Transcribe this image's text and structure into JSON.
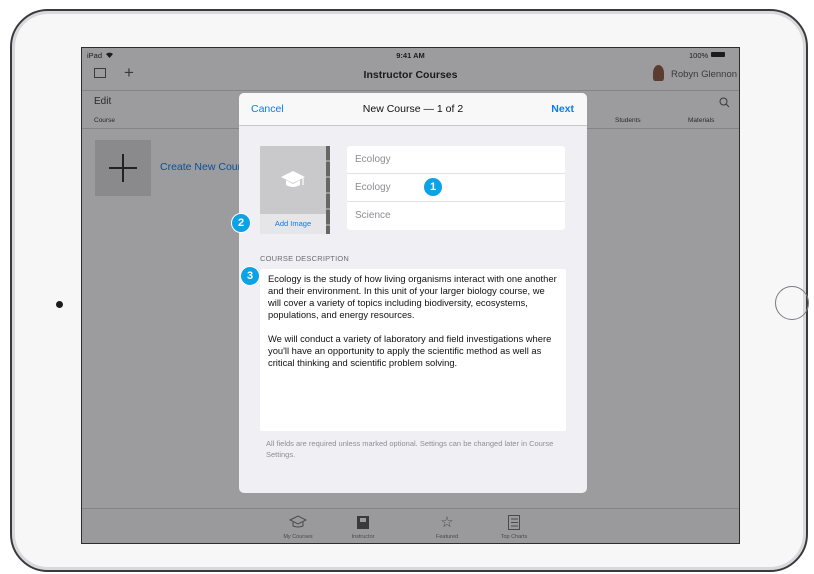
{
  "status": {
    "carrier": "iPad",
    "time": "9:41 AM",
    "battery": "100%"
  },
  "background": {
    "title": "Instructor Courses",
    "user": "Robyn Glennon",
    "edit_label": "Edit",
    "col_course": "Course",
    "col_students": "Students",
    "col_materials": "Materials",
    "create_label": "Create New Course"
  },
  "modal": {
    "cancel": "Cancel",
    "title": "New Course — 1 of 2",
    "next": "Next",
    "add_image": "Add Image",
    "fields": [
      "Ecology",
      "Ecology",
      "Science"
    ],
    "section_label": "COURSE DESCRIPTION",
    "description": [
      "Ecology is the study of how living organisms interact with one another and their environment. In this unit of your larger biology course, we will cover a variety of topics including biodiversity, ecosystems, populations, and energy resources.",
      "We will conduct a variety of laboratory and field investigations where you'll have an opportunity to apply the scientific method as well as critical thinking and scientific problem solving."
    ],
    "footnote": "All fields are required unless marked optional. Settings can be changed later in Course Settings."
  },
  "badges": [
    "1",
    "2",
    "3"
  ],
  "tabs": [
    {
      "label": "My Courses",
      "icon": "graduation-cap-icon"
    },
    {
      "label": "Instructor",
      "icon": "instructor-icon"
    },
    {
      "label": "Featured",
      "icon": "star-icon"
    },
    {
      "label": "Top Charts",
      "icon": "list-icon"
    }
  ],
  "colors": {
    "accent": "#0a7cf0",
    "badge": "#0ba2e6",
    "dim_overlay": "#9c9c9f"
  }
}
